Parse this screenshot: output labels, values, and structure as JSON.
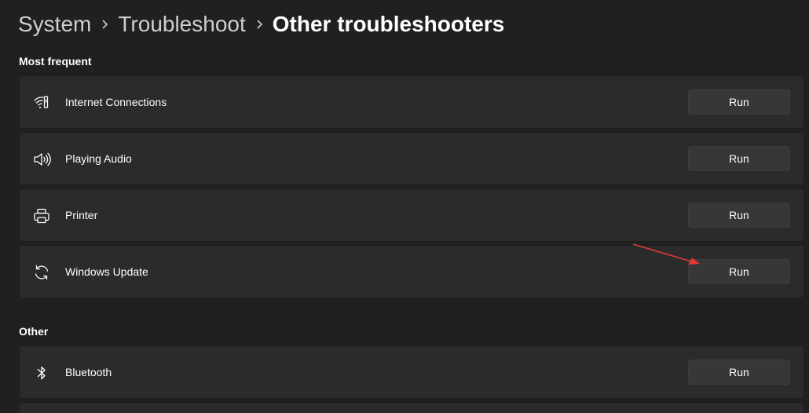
{
  "breadcrumb": {
    "items": [
      "System",
      "Troubleshoot",
      "Other troubleshooters"
    ]
  },
  "sections": {
    "most_frequent": {
      "title": "Most frequent",
      "items": [
        {
          "label": "Internet Connections",
          "icon": "wifi-network-icon",
          "button": "Run"
        },
        {
          "label": "Playing Audio",
          "icon": "speaker-icon",
          "button": "Run"
        },
        {
          "label": "Printer",
          "icon": "printer-icon",
          "button": "Run"
        },
        {
          "label": "Windows Update",
          "icon": "sync-icon",
          "button": "Run"
        }
      ]
    },
    "other": {
      "title": "Other",
      "items": [
        {
          "label": "Bluetooth",
          "icon": "bluetooth-icon",
          "button": "Run"
        }
      ]
    }
  },
  "colors": {
    "background": "#202020",
    "card": "#2b2b2b",
    "button": "#373737",
    "annotation_arrow": "#e53935"
  }
}
